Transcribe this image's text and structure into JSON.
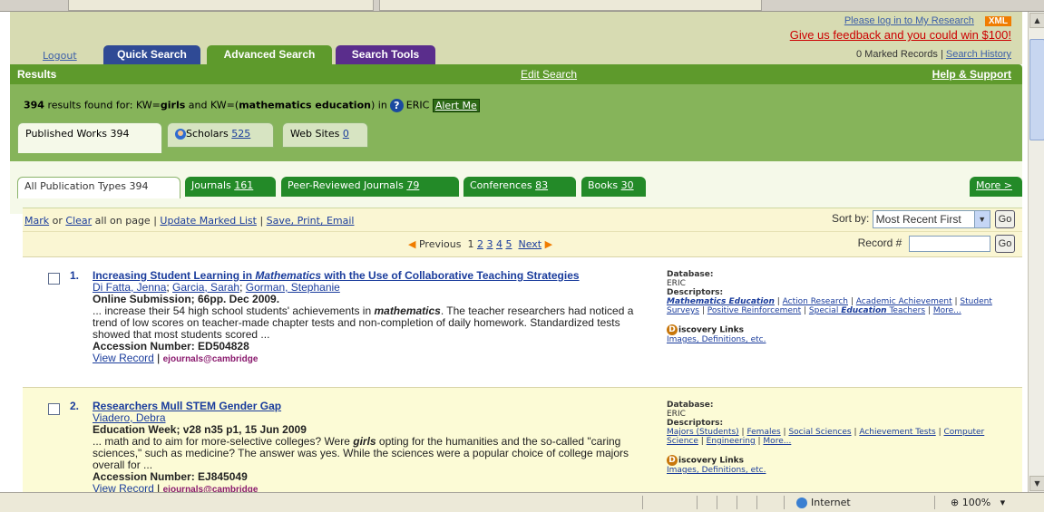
{
  "header": {
    "login_link": "Please log in to My Research",
    "xml_badge": "XML",
    "feedback_link": "Give us feedback and you could win $100!",
    "marked_records": "0 Marked Records",
    "separator": "|",
    "search_history": "Search History",
    "logout": "Logout",
    "tabs": {
      "quick": "Quick Search",
      "advanced": "Advanced Search",
      "tools": "Search Tools"
    }
  },
  "results_bar": {
    "title": "Results",
    "edit": "Edit Search",
    "help": "Help & Support"
  },
  "summary": {
    "count": "394",
    "found_for": " results found for: KW=",
    "term1": "girls",
    "and_kw": " and KW=(",
    "term2": "mathematics education",
    "close_in": ") in",
    "help_glyph": "?",
    "db": "ERIC",
    "alert": "Alert Me"
  },
  "source_tabs": {
    "published": "Published Works 394",
    "scholars_label": "Scholars",
    "scholars_count": "525",
    "web_label": "Web Sites",
    "web_count": "0"
  },
  "pub_tabs": {
    "all": "All Publication Types 394",
    "journals_label": "Journals",
    "journals_count": "161",
    "peer_label": "Peer-Reviewed Journals",
    "peer_count": "79",
    "conf_label": "Conferences",
    "conf_count": "83",
    "books_label": "Books",
    "books_count": "30",
    "more": "More >"
  },
  "actions": {
    "mark": "Mark",
    "or": "or",
    "clear": "Clear",
    "on_page": "all on page |",
    "update": "Update Marked List",
    "pipe": "|",
    "save": "Save, Print, Email",
    "sort_by": "Sort by:",
    "sort_value": "Most Recent First",
    "go": "Go"
  },
  "pager": {
    "prev_arrow": "◀",
    "prev": "Previous",
    "pages": [
      "1",
      "2",
      "3",
      "4",
      "5"
    ],
    "next": "Next",
    "next_arrow": "▶",
    "record_label": "Record #",
    "go": "Go"
  },
  "results": [
    {
      "num": "1.",
      "title_a": "Increasing Student Learning in ",
      "title_em": "Mathematics",
      "title_b": " with the Use of Collaborative Teaching Strategies",
      "author1": "Di Fatta, Jenna",
      "author2": "Garcia, Sarah",
      "author3": "Gorman, Stephanie",
      "source": "Online Submission; 66pp. Dec 2009.",
      "snip_a": "... increase their 54 high school students' achievements in ",
      "snip_em": "mathematics",
      "snip_b": ". The teacher researchers had noticed a trend of low scores on teacher-made chapter tests and non-completion of daily homework. Standardized tests showed that most students scored ...",
      "accession": "Accession Number: ED504828",
      "view": "View Record",
      "pipe": "|",
      "ejournals": "ejournals@cambridge",
      "db_label": "Database:",
      "db": "ERIC",
      "desc_label": "Descriptors:",
      "descriptors": [
        "Mathematics Education",
        "Action Research",
        "Academic Achievement",
        "Student Surveys",
        "Positive Reinforcement"
      ],
      "desc_last_a": "Special ",
      "desc_last_em": "Education",
      "desc_last_b": " Teachers",
      "more": "More...",
      "disc_glyph": "D",
      "disc": "iscovery Links",
      "images": "Images, Definitions, etc."
    },
    {
      "num": "2.",
      "title": "Researchers Mull STEM Gender Gap",
      "author1": "Viadero, Debra",
      "source": "Education Week; v28 n35 p1, 15 Jun 2009",
      "snip_a": "... math and to aim for more-selective colleges? Were ",
      "snip_em": "girls",
      "snip_b": " opting for the humanities and the so-called \"caring sciences,\" such as medicine? The answer was yes. While the sciences were a popular choice of college majors overall for ...",
      "accession": "Accession Number: EJ845049",
      "view": "View Record",
      "pipe": "|",
      "ejournals": "ejournals@cambridge",
      "db_label": "Database:",
      "db": "ERIC",
      "desc_label": "Descriptors:",
      "descriptors": [
        "Majors (Students)",
        "Females",
        "Social Sciences",
        "Achievement Tests",
        "Computer Science",
        "Engineering"
      ],
      "more": "More...",
      "disc_glyph": "D",
      "disc": "iscovery Links",
      "images": "Images, Definitions, etc."
    }
  ],
  "statusbar": {
    "zone": "Internet",
    "zoom": "⊕ 100%",
    "zoom_menu": "▾"
  },
  "scroll": {
    "up": "▲",
    "down": "▼"
  }
}
